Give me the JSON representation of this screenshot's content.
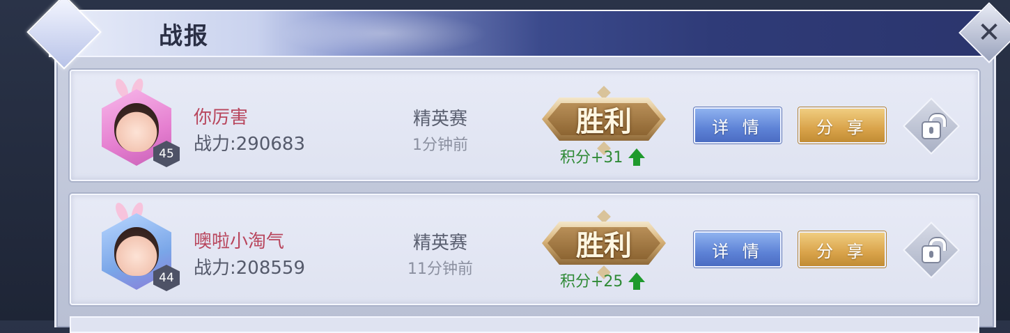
{
  "window": {
    "title": "战报",
    "close_icon": "close-icon"
  },
  "battles": [
    {
      "player_name": "你厉害",
      "level": "45",
      "power": "战力:290683",
      "mode": "精英赛",
      "time_ago": "1分钟前",
      "result": "胜利",
      "score": "积分+31",
      "detail_label": "详 情",
      "share_label": "分 享",
      "avatar_frame_color": "#e57fd0",
      "name_color": "#b8455c"
    },
    {
      "player_name": "噢啦小淘气",
      "level": "44",
      "power": "战力:208559",
      "mode": "精英赛",
      "time_ago": "11分钟前",
      "result": "胜利",
      "score": "积分+25",
      "detail_label": "详 情",
      "share_label": "分 享",
      "avatar_frame_color": "#7aa6e8",
      "name_color": "#b8455c"
    }
  ],
  "colors": {
    "victory_gold": "#b88f58",
    "score_green": "#2f8a36",
    "detail_blue": "#5d82d6",
    "share_gold": "#d9a34a"
  }
}
